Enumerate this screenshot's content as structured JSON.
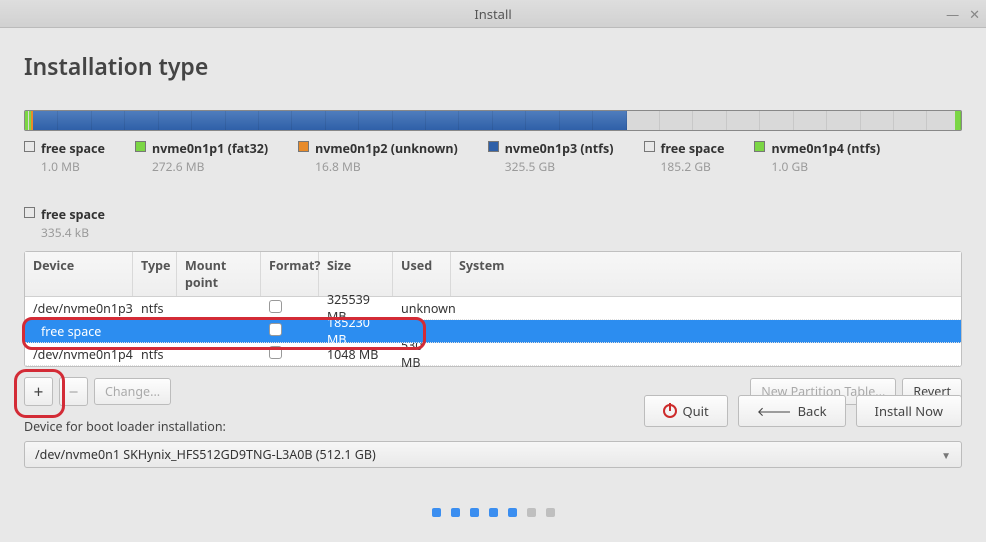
{
  "window": {
    "title": "Install"
  },
  "page_title": "Installation type",
  "legend": [
    {
      "name": "free space",
      "size": "1.0 MB",
      "color": "",
      "hollow": true
    },
    {
      "name": "nvme0n1p1 (fat32)",
      "size": "272.6 MB",
      "color": "#7bd644"
    },
    {
      "name": "nvme0n1p2 (unknown)",
      "size": "16.8 MB",
      "color": "#e88b2a"
    },
    {
      "name": "nvme0n1p3 (ntfs)",
      "size": "325.5 GB",
      "color": "#2f60a8"
    },
    {
      "name": "free space",
      "size": "185.2 GB",
      "color": "",
      "hollow": true
    },
    {
      "name": "nvme0n1p4 (ntfs)",
      "size": "1.0 GB",
      "color": "#7bd644"
    },
    {
      "name": "free space",
      "size": "335.4 kB",
      "color": "",
      "hollow": true
    }
  ],
  "columns": {
    "device": "Device",
    "type": "Type",
    "mount": "Mount point",
    "format": "Format?",
    "size": "Size",
    "used": "Used",
    "system": "System"
  },
  "rows": [
    {
      "device": "/dev/nvme0n1p3",
      "type": "ntfs",
      "mount": "",
      "format": false,
      "size": "325539 MB",
      "used": "unknown",
      "system": "",
      "selected": false
    },
    {
      "device": "free space",
      "type": "",
      "mount": "",
      "format": false,
      "size": "185230 MB",
      "used": "",
      "system": "",
      "selected": true
    },
    {
      "device": "/dev/nvme0n1p4",
      "type": "ntfs",
      "mount": "",
      "format": false,
      "size": "1048 MB",
      "used": "530 MB",
      "system": "",
      "selected": false
    }
  ],
  "toolbar": {
    "add": "+",
    "remove": "−",
    "change": "Change...",
    "new_table": "New Partition Table...",
    "revert": "Revert"
  },
  "bootloader_label": "Device for boot loader installation:",
  "bootloader_value": "/dev/nvme0n1     SKHynix_HFS512GD9TNG-L3A0B (512.1 GB)",
  "footer": {
    "quit": "Quit",
    "back": "Back",
    "install": "Install Now"
  }
}
